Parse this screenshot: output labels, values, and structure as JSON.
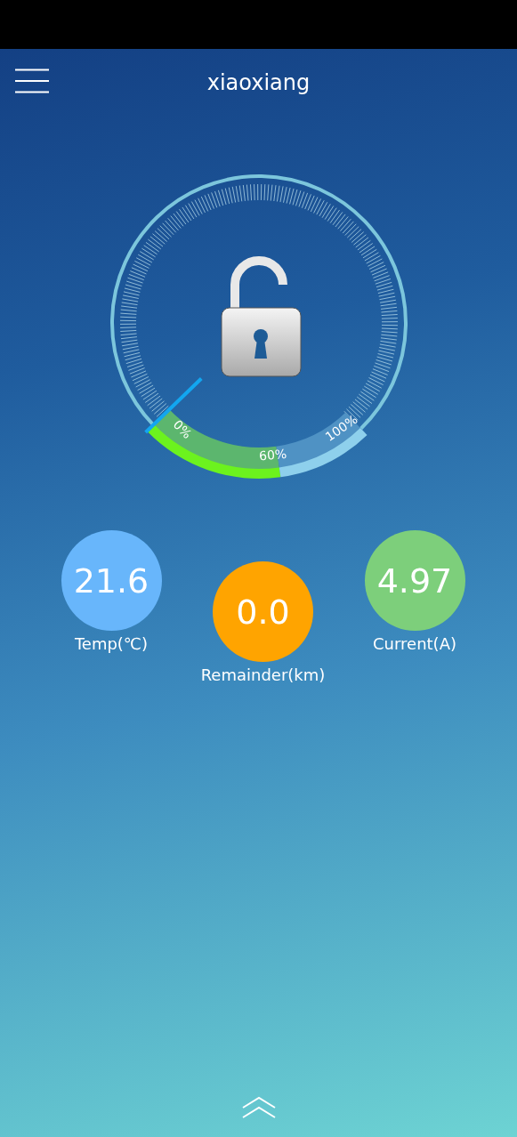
{
  "header": {
    "title": "xiaoxiang"
  },
  "gauge": {
    "locked": false,
    "labels": [
      "0%",
      "60%",
      "100%"
    ]
  },
  "stats": [
    {
      "value": "21.6",
      "label": "Temp(℃)",
      "color": "#68b6fb"
    },
    {
      "value": "0.0",
      "label": "Remainder(km)",
      "color": "#ffa400"
    },
    {
      "value": "4.97",
      "label": "Current(A)",
      "color": "#7dcf7b"
    }
  ]
}
